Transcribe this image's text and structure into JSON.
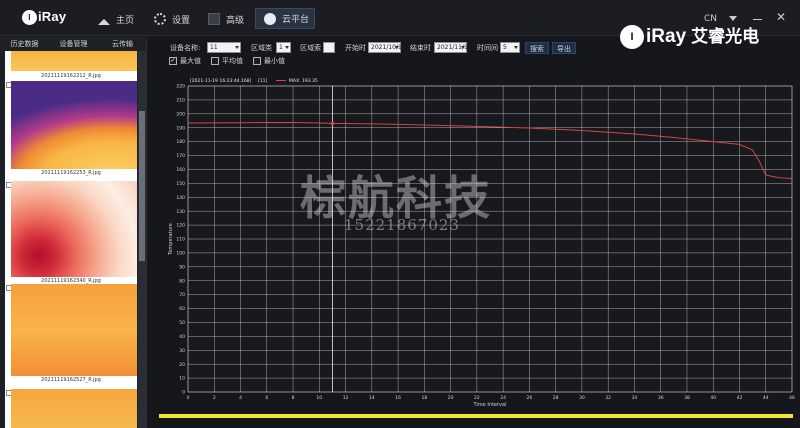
{
  "header": {
    "logo": "iRay",
    "nav": [
      {
        "label": "主页",
        "icon": "home-icon"
      },
      {
        "label": "设置",
        "icon": "gear-icon"
      },
      {
        "label": "高级",
        "icon": "advanced-icon"
      },
      {
        "label": "云平台",
        "icon": "cloud-icon"
      }
    ],
    "brand": "iRay",
    "brand_cn": "艾睿光电",
    "language": "CN"
  },
  "sidebar": {
    "tabs": [
      "历史数据",
      "设备管理",
      "云传输"
    ],
    "thumbnails": [
      {
        "caption": "20211119162212_R.jpg"
      },
      {
        "caption": "20211119162253_R.jpg"
      },
      {
        "caption": "20211119162340_R.jpg"
      },
      {
        "caption": "20211119162527_R.jpg"
      }
    ]
  },
  "filters": {
    "device_label": "设备名称:",
    "device_value": "11",
    "region_type_label": "区域类",
    "region_type_value": "1",
    "region_label": "区域索",
    "start_label": "开始时",
    "start_value": "2021/10/1",
    "end_label": "结束时",
    "end_value": "2021/11/1",
    "interval_label": "时间间",
    "interval_value": "5",
    "search_label": "搜索",
    "export_label": "导出"
  },
  "options": {
    "max_label": "最大值",
    "avg_label": "平均值",
    "min_label": "最小值",
    "max_checked": true,
    "avg_checked": false,
    "min_checked": false
  },
  "chart_data": {
    "type": "line",
    "title": "2021-11-19 16:23:44.168",
    "legend_box": "[11]",
    "series": [
      {
        "name": "MAX: 193.35",
        "color": "#d6434c",
        "x": [
          0,
          4,
          8,
          10,
          11,
          14,
          18,
          22,
          26,
          30,
          34,
          37,
          40,
          42,
          43,
          43.5,
          44,
          45,
          46
        ],
        "y": [
          193.4,
          193.6,
          193.8,
          193.4,
          193.1,
          192.8,
          192.0,
          191.0,
          189.8,
          188.0,
          185.5,
          183.0,
          180.0,
          178.0,
          174.0,
          166.0,
          156.0,
          154.0,
          153.5
        ]
      }
    ],
    "xlabel": "Time Interval",
    "ylabel": "Temperature",
    "xlim": [
      0,
      46
    ],
    "ylim": [
      0,
      220
    ],
    "x_ticks": [
      0,
      2,
      4,
      6,
      8,
      10,
      12,
      14,
      16,
      18,
      20,
      22,
      24,
      26,
      28,
      30,
      32,
      34,
      36,
      38,
      40,
      42,
      44,
      46
    ],
    "y_ticks": [
      0,
      10,
      20,
      30,
      40,
      50,
      60,
      70,
      80,
      90,
      100,
      110,
      120,
      130,
      140,
      150,
      160,
      170,
      180,
      190,
      200,
      210,
      220
    ],
    "cursor_x": 11,
    "grid": true,
    "background": "#17191d",
    "grid_color": "#d8dadd"
  },
  "watermark": {
    "text": "棕航科技",
    "phone": "15221867023"
  }
}
